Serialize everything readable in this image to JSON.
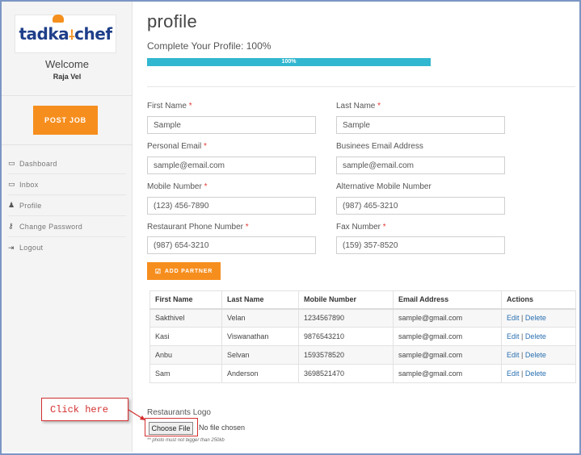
{
  "sidebar": {
    "logo_text": "tadka",
    "logo_text_2": "chef",
    "welcome": "Welcome",
    "username": "Raja Vel",
    "post_job": "POST JOB",
    "nav": [
      {
        "icon": "monitor-icon",
        "label": "Dashboard"
      },
      {
        "icon": "inbox-icon",
        "label": "Inbox"
      },
      {
        "icon": "user-icon",
        "label": "Profile"
      },
      {
        "icon": "key-icon",
        "label": "Change Password"
      },
      {
        "icon": "logout-icon",
        "label": "Logout"
      }
    ]
  },
  "main": {
    "title": "profile",
    "complete_label": "Complete Your Profile: 100%",
    "progress_value": 1.0,
    "progress_text": "100%",
    "fields": {
      "first_name": {
        "label": "First Name",
        "value": "Sample"
      },
      "last_name": {
        "label": "Last Name",
        "value": "Sample"
      },
      "personal_email": {
        "label": "Personal Email",
        "value": "sample@email.com"
      },
      "business_email": {
        "label": "Businees Email Address",
        "value": "sample@email.com"
      },
      "mobile": {
        "label": "Mobile Number",
        "value": "(123) 456-7890"
      },
      "alt_mobile": {
        "label": "Alternative Mobile Number",
        "value": "(987) 465-3210"
      },
      "restaurant_phone": {
        "label": "Restaurant Phone Number",
        "value": "(987) 654-3210"
      },
      "fax": {
        "label": "Fax Number",
        "value": "(159) 357-8520"
      }
    },
    "required_mark": "*",
    "add_partner": "ADD PARTNER",
    "table": {
      "headers": [
        "First Name",
        "Last Name",
        "Mobile Number",
        "Email Address",
        "Actions"
      ],
      "rows": [
        [
          "Sakthivel",
          "Velan",
          "1234567890",
          "sample@gmail.com"
        ],
        [
          "Kasi",
          "Viswanathan",
          "9876543210",
          "sample@gmail.com"
        ],
        [
          "Anbu",
          "Selvan",
          "1593578520",
          "sample@gmail.com"
        ],
        [
          "Sam",
          "Anderson",
          "3698521470",
          "sample@gmail.com"
        ]
      ],
      "edit_label": "Edit",
      "separator": "|",
      "delete_label": "Delete"
    },
    "logo_label": "Restaurants Logo",
    "choose_file": "Choose File",
    "no_file": "No file chosen",
    "note": "** photo must not bigger than 250kb"
  },
  "annotation": {
    "callout_text": "Click here"
  },
  "colors": {
    "accent_orange": "#f68e1e",
    "progress": "#32b7d0",
    "link": "#2a6fb0",
    "callout_red": "#d32f2f"
  }
}
